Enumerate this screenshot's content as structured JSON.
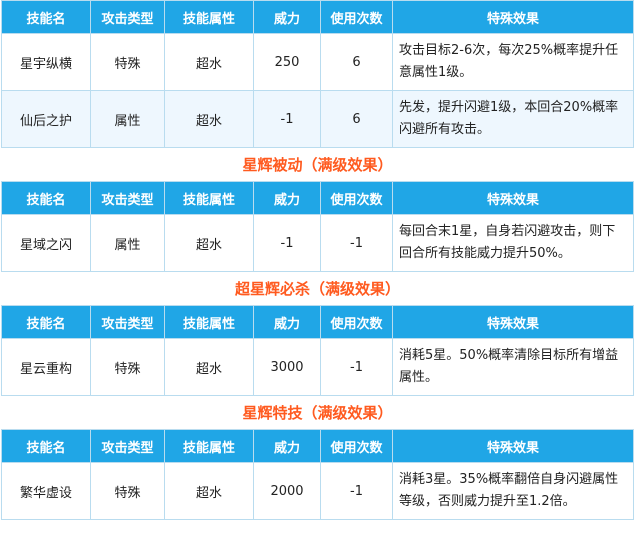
{
  "headers": [
    "技能名",
    "攻击类型",
    "技能属性",
    "威力",
    "使用次数",
    "特殊效果"
  ],
  "blocks": [
    {
      "section_title": null,
      "rows": [
        {
          "name": "星宇纵横",
          "type": "特殊",
          "attr": "超水",
          "power": "250",
          "uses": "6",
          "effect": "攻击目标2-6次，每次25%概率提升任意属性1级。"
        },
        {
          "name": "仙后之护",
          "type": "属性",
          "attr": "超水",
          "power": "-1",
          "uses": "6",
          "effect": "先发，提升闪避1级，本回合20%概率闪避所有攻击。"
        }
      ]
    },
    {
      "section_title": "星辉被动（满级效果）",
      "rows": [
        {
          "name": "星域之闪",
          "type": "属性",
          "attr": "超水",
          "power": "-1",
          "uses": "-1",
          "effect": "每回合末1星，自身若闪避攻击，则下回合所有技能威力提升50%。"
        }
      ]
    },
    {
      "section_title": "超星辉必杀（满级效果）",
      "rows": [
        {
          "name": "星云重构",
          "type": "特殊",
          "attr": "超水",
          "power": "3000",
          "uses": "-1",
          "effect": "消耗5星。50%概率清除目标所有增益属性。"
        }
      ]
    },
    {
      "section_title": "星辉特技（满级效果）",
      "rows": [
        {
          "name": "繁华虚设",
          "type": "特殊",
          "attr": "超水",
          "power": "2000",
          "uses": "-1",
          "effect": "消耗3星。35%概率翻倍自身闪避属性等级，否则威力提升至1.2倍。"
        }
      ]
    }
  ],
  "colors": {
    "header_bg": "#20a6e6",
    "section_title": "#ff5a1f",
    "alt_row_bg": "#eef7fe",
    "border": "#b9dcef"
  }
}
